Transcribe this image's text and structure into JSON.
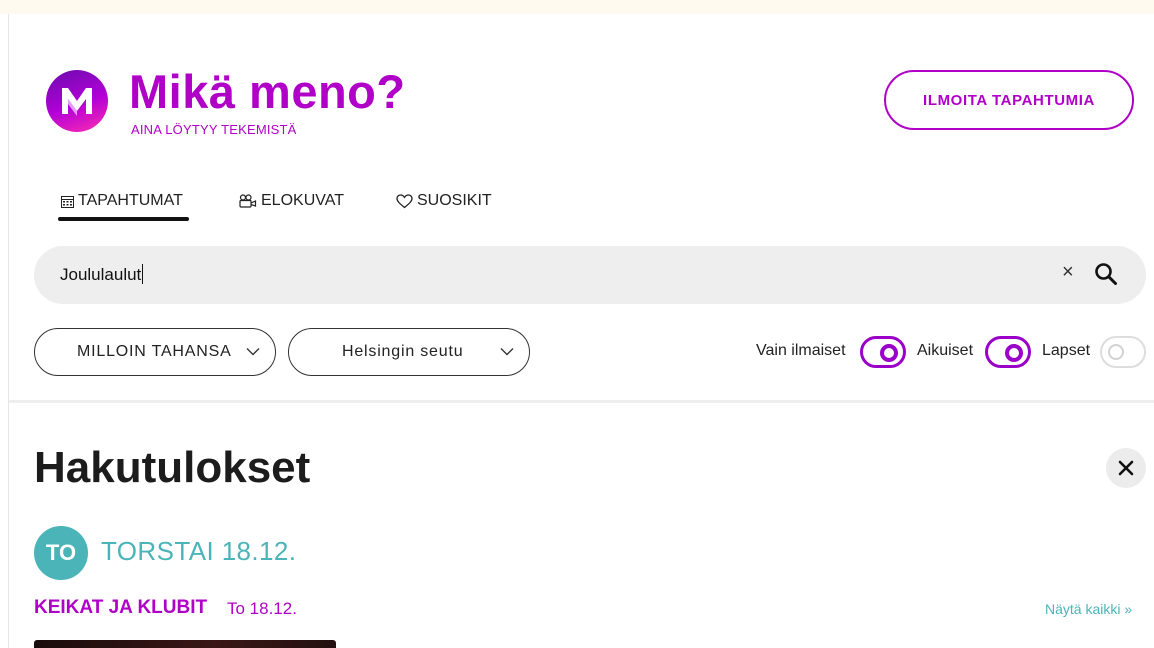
{
  "brand": {
    "title": "Mikä meno?",
    "subtitle": "AINA LÖYTYY TEKEMISTÄ",
    "logo_icon": "mm-logo-icon"
  },
  "header": {
    "report_button": "ILMOITA TAPAHTUMIA"
  },
  "tabs": [
    {
      "label": "TAPAHTUMAT",
      "icon": "calendar-icon",
      "active": true
    },
    {
      "label": "ELOKUVAT",
      "icon": "film-camera-icon",
      "active": false
    },
    {
      "label": "SUOSIKIT",
      "icon": "heart-icon",
      "active": false
    }
  ],
  "search": {
    "value": "Joululaulut",
    "clear_icon": "close-icon",
    "search_icon": "search-icon"
  },
  "filters": {
    "time": "MILLOIN TAHANSA",
    "area": "Helsingin seutu",
    "toggles": [
      {
        "label": "Vain ilmaiset",
        "on": true
      },
      {
        "label": "Aikuiset",
        "on": true
      },
      {
        "label": "Lapset",
        "on": false
      }
    ]
  },
  "results": {
    "title": "Hakutulokset",
    "day_badge": "TO",
    "day_title": "TORSTAI 18.12.",
    "category": "KEIKAT JA KLUBIT",
    "category_date": "To 18.12.",
    "see_all": "Näytä kaikki »"
  },
  "colors": {
    "brand": "#b000c8",
    "accent": "#4bb4b8",
    "toggle_on": "#9b00c8"
  }
}
